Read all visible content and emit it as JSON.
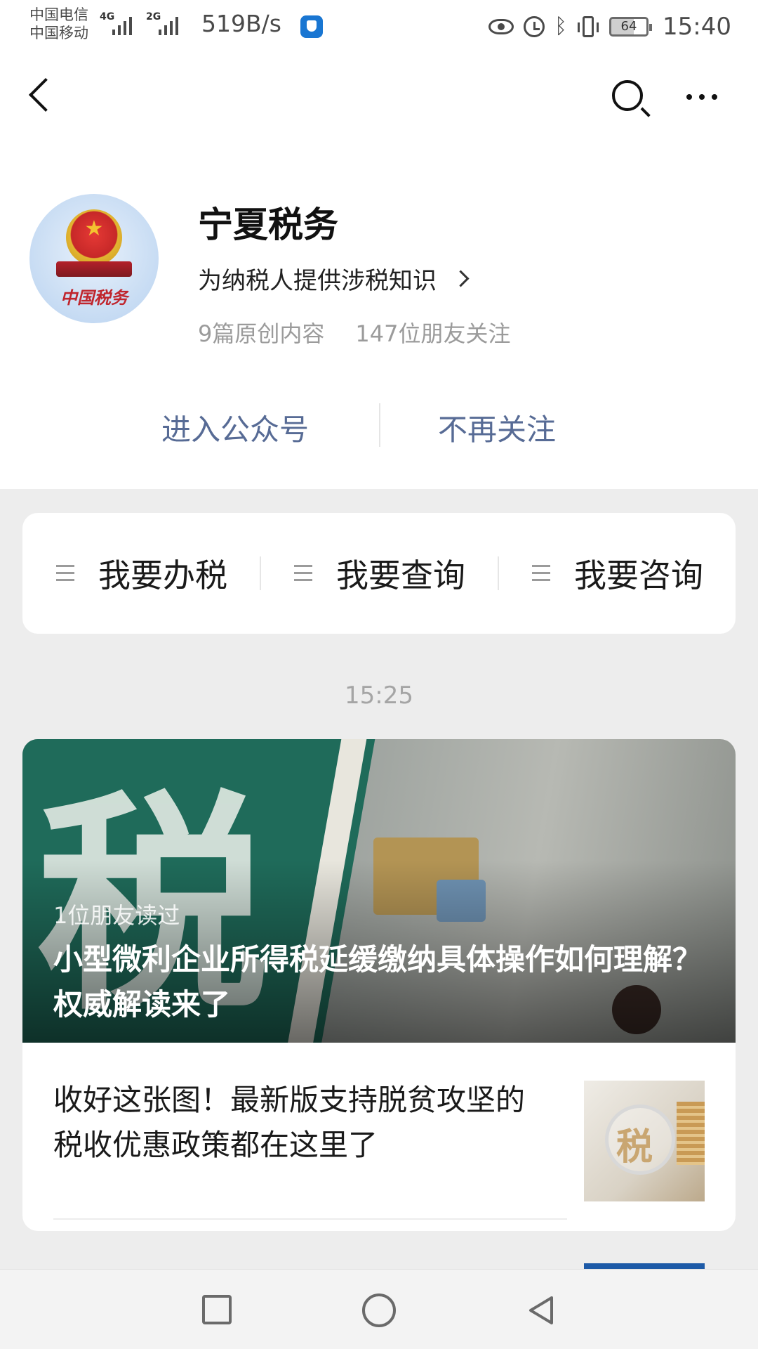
{
  "status_bar": {
    "carrier_1": "中国电信",
    "carrier_2": "中国移动",
    "sim1_network": "4G",
    "sim2_network": "2G",
    "net_speed": "519B/s",
    "battery": "64",
    "time": "15:40"
  },
  "nav": {
    "back_icon": "chevron-left",
    "search_icon": "search",
    "more_icon": "ellipsis"
  },
  "profile": {
    "name": "宁夏税务",
    "description": "为纳税人提供涉税知识",
    "original_count": "9篇原创内容",
    "followers": "147位朋友关注",
    "logo_text": "中国税务",
    "enter_label": "进入公众号",
    "unfollow_label": "不再关注"
  },
  "menu": {
    "items": [
      {
        "label": "我要办税",
        "icon": "menu-lines"
      },
      {
        "label": "我要查询",
        "icon": "menu-lines"
      },
      {
        "label": "我要咨询",
        "icon": "menu-lines"
      }
    ]
  },
  "feed": {
    "time": "15:25",
    "cover": {
      "read_count": "1位朋友读过",
      "title": "小型微利企业所得税延缓缴纳具体操作如何理解？权威解读来了",
      "glyph": "税"
    },
    "articles": [
      {
        "title": "收好这张图！最新版支持脱贫攻坚的税收优惠政策都在这里了",
        "thumb_glyph": "税"
      }
    ]
  },
  "colors": {
    "link_blue": "#576b95",
    "background": "#ededed",
    "cover_green": "#1f6b5a"
  }
}
